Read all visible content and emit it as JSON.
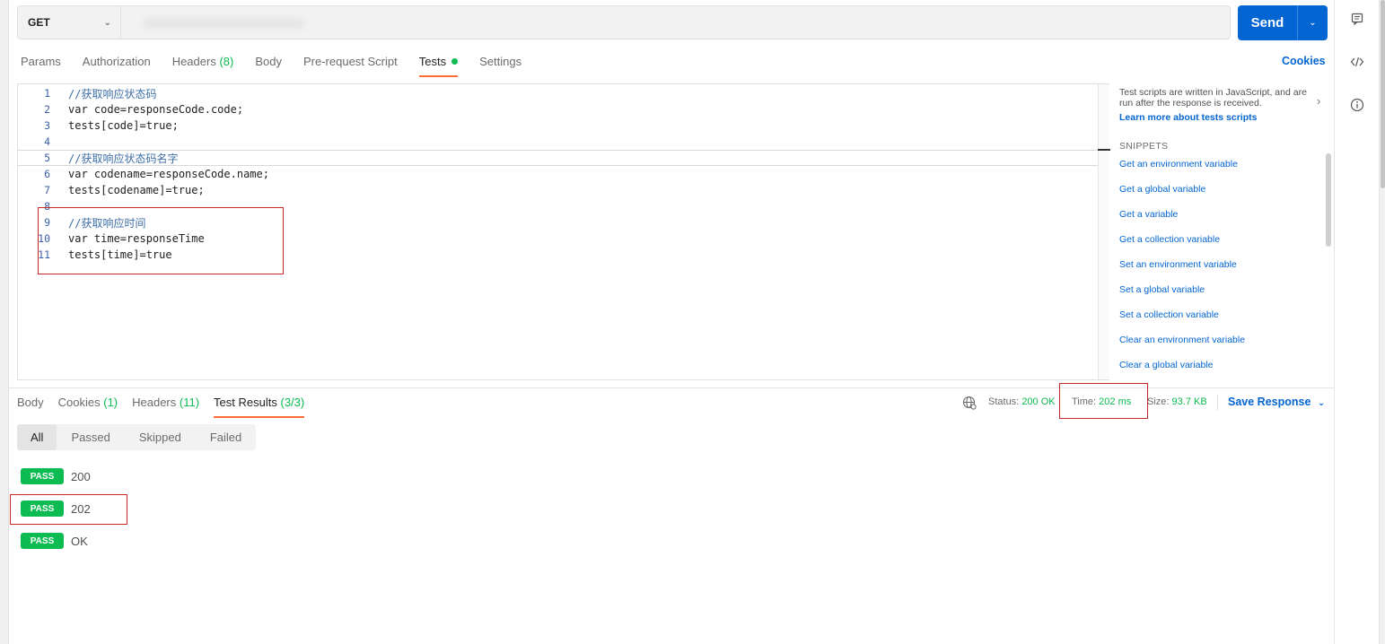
{
  "request": {
    "method": "GET",
    "url": "",
    "send_label": "Send"
  },
  "request_tabs": [
    {
      "label": "Params",
      "count": ""
    },
    {
      "label": "Authorization",
      "count": ""
    },
    {
      "label": "Headers",
      "count": "(8)"
    },
    {
      "label": "Body",
      "count": ""
    },
    {
      "label": "Pre-request Script",
      "count": ""
    },
    {
      "label": "Tests",
      "count": ""
    },
    {
      "label": "Settings",
      "count": ""
    }
  ],
  "active_request_tab": "Tests",
  "cookies_link": "Cookies",
  "editor": {
    "lines": [
      {
        "n": "1",
        "text": "//获取响应状态码"
      },
      {
        "n": "2",
        "text": "var code=responseCode.code;"
      },
      {
        "n": "3",
        "text": "tests[code]=true;"
      },
      {
        "n": "4",
        "text": ""
      },
      {
        "n": "5",
        "text": "//获取响应状态码名字"
      },
      {
        "n": "6",
        "text": "var codename=responseCode.name;"
      },
      {
        "n": "7",
        "text": "tests[codename]=true;"
      },
      {
        "n": "8",
        "text": ""
      },
      {
        "n": "9",
        "text": "//获取响应时间"
      },
      {
        "n": "10",
        "text": "var time=responseTime"
      },
      {
        "n": "11",
        "text": "tests[time]=true"
      }
    ]
  },
  "snippets_panel": {
    "description": "Test scripts are written in JavaScript, and are run after the response is received.",
    "learn_more": "Learn more about tests scripts",
    "title": "SNIPPETS",
    "items": [
      "Get an environment variable",
      "Get a global variable",
      "Get a variable",
      "Get a collection variable",
      "Set an environment variable",
      "Set a global variable",
      "Set a collection variable",
      "Clear an environment variable",
      "Clear a global variable"
    ]
  },
  "response_tabs": [
    {
      "label": "Body",
      "count": ""
    },
    {
      "label": "Cookies",
      "count": "(1)"
    },
    {
      "label": "Headers",
      "count": "(11)"
    },
    {
      "label": "Test Results",
      "count": "(3/3)"
    }
  ],
  "response_meta": {
    "status_label": "Status:",
    "status_value": "200 OK",
    "time_label": "Time:",
    "time_value": "202 ms",
    "size_label": "Size:",
    "size_value": "93.7 KB",
    "save_response": "Save Response"
  },
  "filters": [
    "All",
    "Passed",
    "Skipped",
    "Failed"
  ],
  "active_filter": "All",
  "results": [
    {
      "status": "PASS",
      "name": "200"
    },
    {
      "status": "PASS",
      "name": "202"
    },
    {
      "status": "PASS",
      "name": "OK"
    }
  ],
  "icons": {
    "rail": [
      "comment-icon",
      "code-icon",
      "info-icon"
    ],
    "network": "globe-icon"
  },
  "colors": {
    "accent_blue": "#0265d2",
    "success_green": "#0cbb52",
    "tab_indicator": "#ff6c37",
    "highlight_box": "#c62828"
  }
}
